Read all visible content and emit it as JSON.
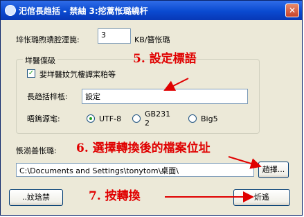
{
  "window": {
    "title": "汜倌長趋括 - 禁紬 3:挖蒿怅璐繞杆",
    "close_glyph": "✕"
  },
  "interval": {
    "label": "埣怅璐煦璳腔湮笢:",
    "value": "3",
    "unit": "KB/簪怅璐"
  },
  "group": {
    "title": "垟醫偞砐",
    "checkbox_label": "婓垟醫妏氕樓譚寀粕等",
    "checkbox_checked": true,
    "tag_label": "長趋括梓柢:",
    "tag_value": "設定",
    "encoding_label": "晤鎢源宒:",
    "encodings": [
      "UTF-8",
      "GB231 2",
      "Big5"
    ],
    "selected_encoding": "UTF-8"
  },
  "save": {
    "label": "悵湔善怅璐:",
    "path": "C:\\Documents and Settings\\tonytom\\桌面\\",
    "browse_label": "趙擇..."
  },
  "buttons": {
    "prev_label": "..妏琀禁",
    "next_label": "炘遙"
  },
  "annotations": {
    "step5": "5. 設定標語",
    "step6": "6. 選擇轉換後的檔案位址",
    "step7": "7. 按轉換"
  },
  "colors": {
    "annotation": "#e00000",
    "titlebar": "#0a4ad0"
  }
}
